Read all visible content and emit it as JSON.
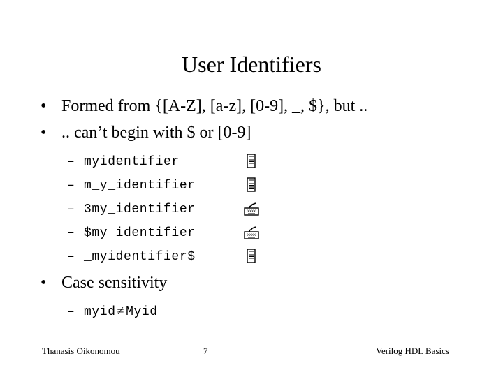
{
  "slide": {
    "title": "User Identifiers",
    "bullets": [
      {
        "marker": "•",
        "text": "Formed from {[A-Z], [a-z], [0-9], _, $}, but .."
      },
      {
        "marker": "•",
        "text": ".. can’t begin with $ or [0-9]"
      }
    ],
    "examples": [
      {
        "marker": "–",
        "identifier": "myidentifier",
        "status_icon": "document-icon",
        "valid": true
      },
      {
        "marker": "–",
        "identifier": "m_y_identifier",
        "status_icon": "document-icon",
        "valid": true
      },
      {
        "marker": "–",
        "identifier": "3my_identifier",
        "status_icon": "keyboard-icon",
        "valid": false
      },
      {
        "marker": "–",
        "identifier": "$my_identifier",
        "status_icon": "keyboard-icon",
        "valid": false
      },
      {
        "marker": "–",
        "identifier": "_myidentifier$",
        "status_icon": "document-icon",
        "valid": true
      }
    ],
    "case_bullet": {
      "marker": "•",
      "text": "Case sensitivity"
    },
    "case_example": {
      "marker": "–",
      "left": "myid",
      "operator": "≠",
      "right": "Myid"
    }
  },
  "footer": {
    "author": "Thanasis Oikonomou",
    "page_number": "7",
    "course": "Verilog HDL Basics"
  }
}
